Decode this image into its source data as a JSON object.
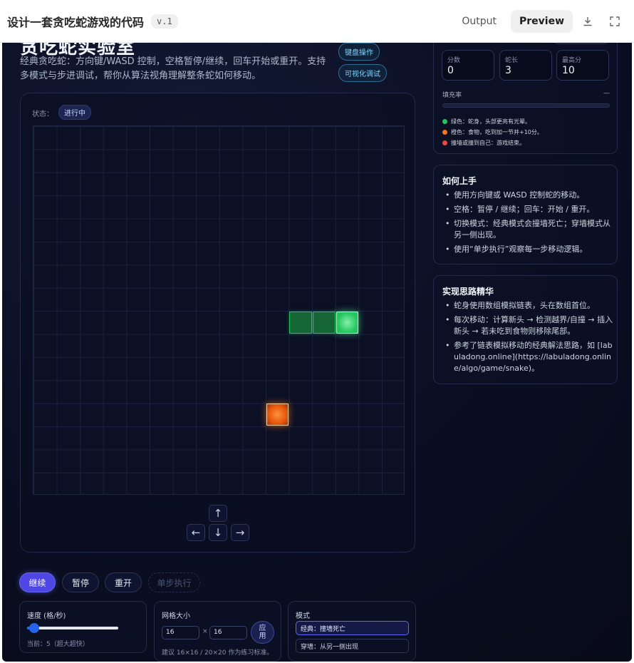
{
  "topbar": {
    "title": "设计一套贪吃蛇游戏的代码",
    "version": "v.1",
    "tabs": [
      "Output",
      "Preview"
    ],
    "active_tab": "Preview"
  },
  "app": {
    "heading": "贪吃蛇实验室",
    "description": "经典贪吃蛇：方向键/WASD 控制，空格暂停/继续，回车开始或重开。支持多模式与步进调试，帮你从算法视角理解整条蛇如何移动。",
    "pills": [
      "键盘操作",
      "可视化调试"
    ]
  },
  "board": {
    "status_label": "状态：",
    "status_value": "进行中",
    "grid_cols": 16,
    "grid_rows": 16,
    "snake": [
      {
        "col": 13,
        "row": 8
      },
      {
        "col": 12,
        "row": 8
      },
      {
        "col": 11,
        "row": 8
      }
    ],
    "food": {
      "col": 10,
      "row": 12
    },
    "dpad": {
      "up": "↑",
      "left": "←",
      "down": "↓",
      "right": "→"
    }
  },
  "controls": {
    "resume": "继续",
    "pause": "暂停",
    "restart": "重开",
    "step": "单步执行"
  },
  "speed": {
    "title": "速度 (格/秒)",
    "current": "当前：5（超大超快）",
    "fraction": 0.08
  },
  "grid_size": {
    "title": "网格大小",
    "width": "16",
    "separator": "×",
    "height": "16",
    "apply": "应用",
    "hint": "建议 16×16 / 20×20 作为练习标准。"
  },
  "mode": {
    "title": "模式",
    "options": [
      "经典：撞墙死亡",
      "穿墙：从另一侧出现"
    ],
    "active": 0
  },
  "stats": {
    "score_label": "分数",
    "score": "0",
    "length_label": "蛇长",
    "length": "3",
    "best_label": "最高分",
    "best": "10",
    "fill_label": "填充率",
    "fill_value": "—"
  },
  "legend": [
    {
      "color": "#22c55e",
      "text": "绿色：蛇身，头部更亮有光晕。"
    },
    {
      "color": "#f97316",
      "text": "橙色：食物，吃到加一节并+10分。"
    },
    {
      "color": "#ef4444",
      "text": "撞墙或撞到自己：游戏结束。"
    }
  ],
  "howto": {
    "title": "如何上手",
    "items": [
      "使用方向键或 WASD 控制蛇的移动。",
      "空格：暂停 / 继续；回车：开始 / 重开。",
      "切换模式：经典模式会撞墙死亡；穿墙模式从另一侧出现。",
      "使用“单步执行”观察每一步移动逻辑。"
    ]
  },
  "algo": {
    "title": "实现思路精华",
    "items": [
      "蛇身使用数组模拟链表，头在数组首位。",
      "每次移动：计算新头 → 检测越界/自撞 → 插入新头 → 若未吃到食物则移除尾部。",
      "参考了链表模拟移动的经典解法思路，如 [labuladong.online](https://labuladong.online/algo/game/snake)。"
    ]
  }
}
